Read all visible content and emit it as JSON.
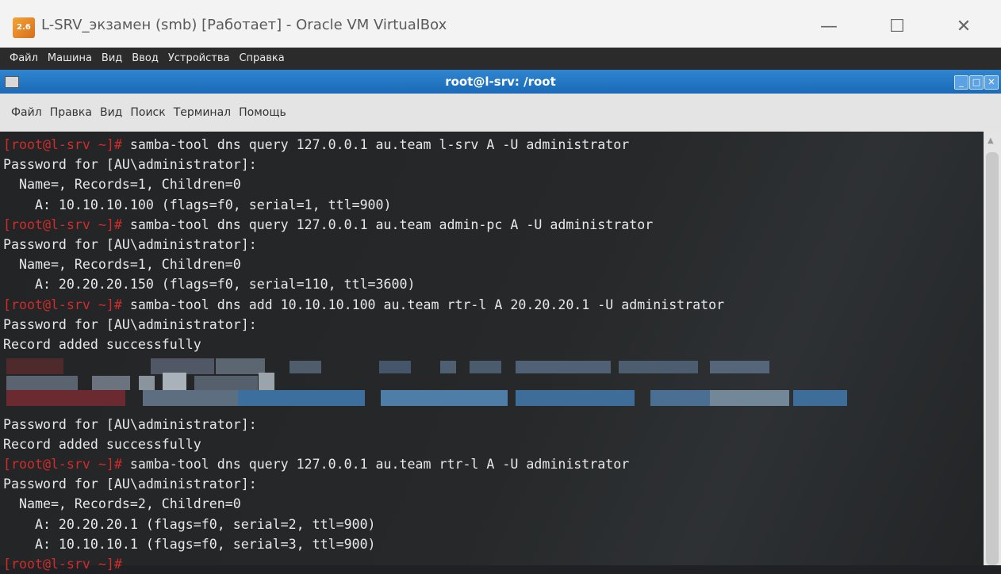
{
  "window": {
    "title": "L-SRV_экзамен (smb) [Работает] - Oracle VM VirtualBox",
    "minimize_glyph": "—",
    "maximize_glyph": "☐",
    "close_glyph": "✕",
    "app_icon": "virtualbox-icon",
    "app_icon_text": "2.6"
  },
  "vbox_menu": [
    "Файл",
    "Машина",
    "Вид",
    "Ввод",
    "Устройства",
    "Справка"
  ],
  "terminal": {
    "title": "root@l-srv: /root",
    "buttons": [
      "_",
      "□",
      "✕"
    ],
    "menu": [
      "Файл",
      "Правка",
      "Вид",
      "Поиск",
      "Терминал",
      "Помощь"
    ],
    "prompt": "[root@l-srv ~]#",
    "lines": [
      {
        "prompt": true,
        "text": " samba-tool dns query 127.0.0.1 au.team l-srv A -U administrator"
      },
      {
        "prompt": false,
        "text": "Password for [AU\\administrator]:"
      },
      {
        "prompt": false,
        "text": "  Name=, Records=1, Children=0"
      },
      {
        "prompt": false,
        "text": "    A: 10.10.10.100 (flags=f0, serial=1, ttl=900)"
      },
      {
        "prompt": true,
        "text": " samba-tool dns query 127.0.0.1 au.team admin-pc A -U administrator"
      },
      {
        "prompt": false,
        "text": "Password for [AU\\administrator]:"
      },
      {
        "prompt": false,
        "text": "  Name=, Records=1, Children=0"
      },
      {
        "prompt": false,
        "text": "    A: 20.20.20.150 (flags=f0, serial=110, ttl=3600)"
      },
      {
        "prompt": true,
        "text": " samba-tool dns add 10.10.10.100 au.team rtr-l A 20.20.20.1 -U administrator"
      },
      {
        "prompt": false,
        "text": "Password for [AU\\administrator]:"
      },
      {
        "prompt": false,
        "text": "Record added successfully"
      },
      {
        "prompt": false,
        "text": ""
      },
      {
        "prompt": false,
        "text": ""
      },
      {
        "prompt": false,
        "text": ""
      },
      {
        "prompt": false,
        "text": "Password for [AU\\administrator]:"
      },
      {
        "prompt": false,
        "text": "Record added successfully"
      },
      {
        "prompt": true,
        "text": " samba-tool dns query 127.0.0.1 au.team rtr-l A -U administrator"
      },
      {
        "prompt": false,
        "text": "Password for [AU\\administrator]:"
      },
      {
        "prompt": false,
        "text": "  Name=, Records=2, Children=0"
      },
      {
        "prompt": false,
        "text": "    A: 20.20.20.1 (flags=f0, serial=2, ttl=900)"
      },
      {
        "prompt": false,
        "text": "    A: 10.10.10.1 (flags=f0, serial=3, ttl=900)"
      },
      {
        "prompt": true,
        "text": ""
      }
    ],
    "colors": {
      "prompt": "#d12c2c",
      "text": "#e8e8e8",
      "titlebar": "#1f73c4"
    }
  }
}
